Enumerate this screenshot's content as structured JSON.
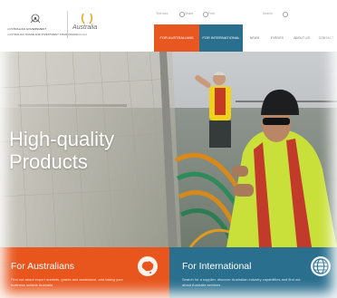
{
  "header": {
    "gov_logo_line1": "AUSTRALIAN GOVERNMENT",
    "gov_logo_line2": "AUSTRALIAN TRADE AND INVESTMENT COMMISSION",
    "brand_logo_text": "Australia",
    "brand_logo_sub": "unlimited",
    "utility": {
      "text_size_label": "Text size",
      "share_label": "Share",
      "print_label": "Print",
      "search_label": "Search"
    },
    "tabs": [
      {
        "label": "FOR AUSTRALIANS"
      },
      {
        "label": "FOR INTERNATIONAL"
      }
    ],
    "links": [
      {
        "label": "NEWS"
      },
      {
        "label": "EVENTS"
      },
      {
        "label": "ABOUT US"
      },
      {
        "label": "CONTACT"
      }
    ]
  },
  "hero": {
    "title_line1": "High-quality",
    "title_line2": "Products"
  },
  "panels": {
    "australians": {
      "title": "For Australians",
      "description": "Find out about export markets, grants and assistance, and taking your business outside Australia"
    },
    "international": {
      "title": "For International",
      "description": "Search for a supplier, discover Australian industry capabilities and find out about Australia services"
    }
  },
  "colors": {
    "accent_orange": "#e8561e",
    "accent_blue": "#2a6f8e"
  },
  "icons": {
    "australians_panel_icon": "australia-map-icon",
    "international_panel_icon": "globe-icon"
  }
}
